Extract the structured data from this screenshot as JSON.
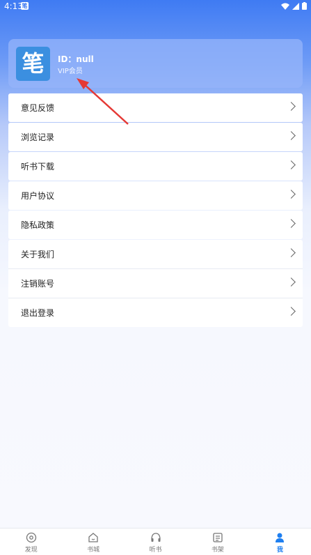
{
  "status_bar": {
    "time": "4:13",
    "app_icon_text": "笔"
  },
  "profile": {
    "avatar_text": "笔",
    "id_text": "ID：null",
    "level": "VIP会员"
  },
  "menu": {
    "items": [
      {
        "label": "意见反馈",
        "name": "feedback"
      },
      {
        "label": "浏览记录",
        "name": "browse-history"
      },
      {
        "label": "听书下载",
        "name": "audiobook-download"
      },
      {
        "label": "用户协议",
        "name": "user-agreement"
      },
      {
        "label": "隐私政策",
        "name": "privacy-policy"
      },
      {
        "label": "关于我们",
        "name": "about-us"
      },
      {
        "label": "注销账号",
        "name": "delete-account"
      },
      {
        "label": "退出登录",
        "name": "logout"
      }
    ]
  },
  "bottom_nav": {
    "items": [
      {
        "label": "发现",
        "icon": "compass-icon"
      },
      {
        "label": "书城",
        "icon": "home-icon"
      },
      {
        "label": "听书",
        "icon": "headphones-icon"
      },
      {
        "label": "书架",
        "icon": "bookshelf-icon"
      },
      {
        "label": "我",
        "icon": "person-icon"
      }
    ],
    "active": "我"
  },
  "colors": {
    "accent": "#1e7ff0",
    "annotation_arrow": "#e53935"
  }
}
